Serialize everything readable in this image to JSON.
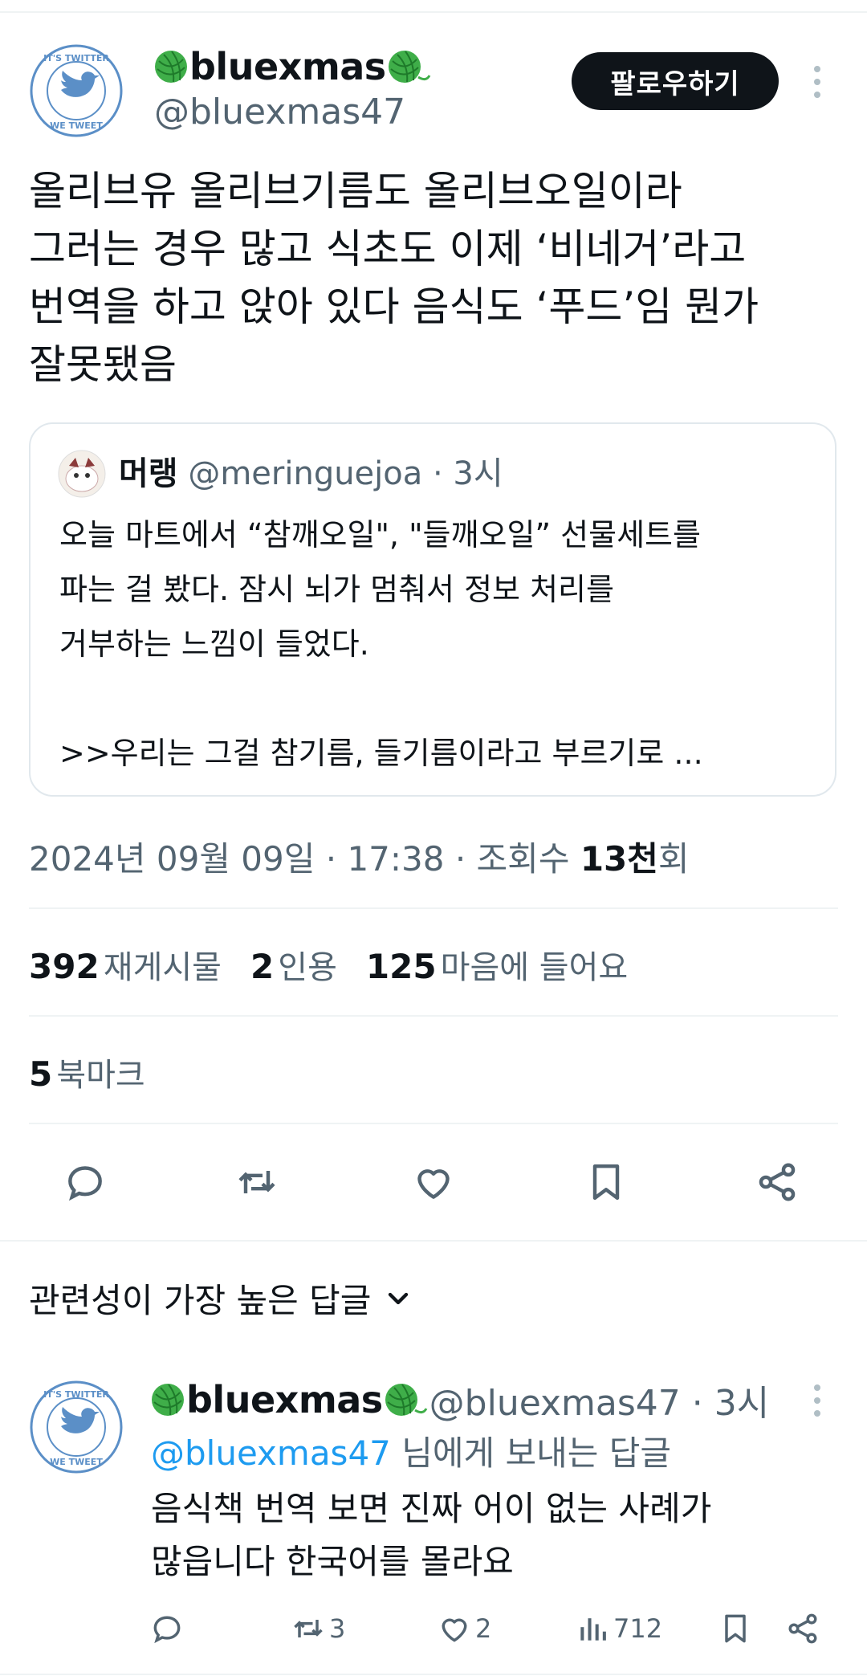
{
  "tweet": {
    "display_name": "bluexmas",
    "handle": "@bluexmas47",
    "follow_label": "팔로우하기",
    "text_lines": [
      "올리브유 올리브기름도 올리브오일이라",
      "그러는 경우 많고 식초도 이제 ‘비네거’라고",
      "번역을 하고 앉아 있다 음식도 ‘푸드’임 뭔가",
      "잘못됐음"
    ],
    "avatar_ring_text_top": "IT'S TWITTER",
    "avatar_ring_text_bottom": "WE TWEET",
    "timestamp_prefix": "2024년 09월 09일 · 17:38 · 조회수 ",
    "views_number": "13천",
    "views_suffix": "회"
  },
  "quote": {
    "display_name": "머랭",
    "handle_time": "@meringuejoa · 3시",
    "text_lines": [
      "오늘 마트에서 “참깨오일\", \"들깨오일” 선물세트를",
      "파는 걸 봤다. 잠시 뇌가 멈춰서 정보 처리를",
      "거부하는 느낌이 들었다.",
      "",
      ">>우리는 그걸 참기름, 들기름이라고 부르기로 ..."
    ]
  },
  "metrics": {
    "retweets_num": "392",
    "retweets_label": "재게시물",
    "quotes_num": "2",
    "quotes_label": "인용",
    "likes_num": "125",
    "likes_label": "마음에 들어요",
    "bookmarks_num": "5",
    "bookmarks_label": "북마크"
  },
  "sort": {
    "label": "관련성이 가장 높은 답글"
  },
  "reply": {
    "display_name": "bluexmas",
    "handle_time": "@bluexmas47 · 3시",
    "replying_to_handle": "@bluexmas47",
    "replying_to_suffix": " 님에게 보내는 답글",
    "text_lines": [
      "음식책 번역 보면 진짜 어이 없는 사례가",
      "많읍니다 한국어를 몰라요"
    ],
    "retweet_count": "3",
    "like_count": "2",
    "view_count": "712"
  },
  "colors": {
    "accent": "#1d9bf0",
    "text": "#0f1419",
    "secondary": "#536471",
    "yarn": "#3fae49"
  },
  "icons": [
    "reply-icon",
    "retweet-icon",
    "like-icon",
    "bookmark-icon",
    "share-icon",
    "more-icon",
    "chevron-down-icon",
    "views-icon",
    "yarn-emoji"
  ]
}
